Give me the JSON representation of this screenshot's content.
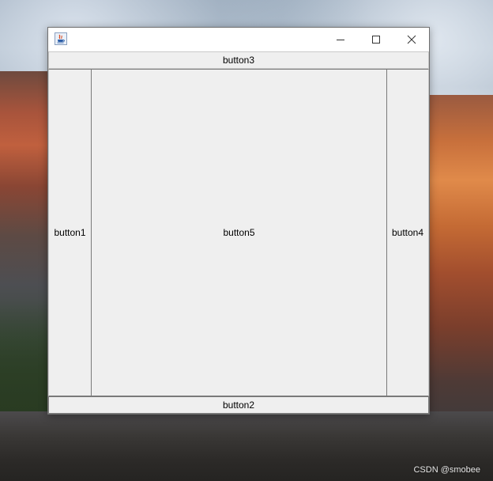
{
  "desktop": {
    "watermark": "CSDN @smobee"
  },
  "window": {
    "title": "",
    "controls": {
      "minimize": "minimize-icon",
      "maximize": "maximize-icon",
      "close": "close-icon"
    },
    "buttons": {
      "north": "button3",
      "west": "button1",
      "center": "button5",
      "east": "button4",
      "south": "button2"
    }
  },
  "colors": {
    "window_bg": "#f0f0f0",
    "titlebar_bg": "#ffffff",
    "button_border": "#7a7a7a"
  }
}
